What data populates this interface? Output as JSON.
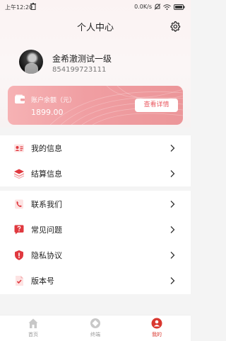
{
  "status": {
    "time": "上午12:20",
    "network": "0.0K/s",
    "battery": "100"
  },
  "header": {
    "title": "个人中心"
  },
  "profile": {
    "name": "金希澈测试一级",
    "phone": "854199723111"
  },
  "account": {
    "label": "账户余额（元）",
    "amount": "1899.00",
    "detail_button": "查看详情"
  },
  "menu_group1": [
    {
      "label": "我的信息",
      "icon": "id-card-icon"
    },
    {
      "label": "结算信息",
      "icon": "stack-icon"
    }
  ],
  "menu_group2": [
    {
      "label": "联系我们",
      "icon": "phone-icon"
    },
    {
      "label": "常见问题",
      "icon": "question-icon"
    },
    {
      "label": "隐私协议",
      "icon": "shield-icon"
    },
    {
      "label": "版本号",
      "icon": "document-icon"
    }
  ],
  "tabs": [
    {
      "label": "首页",
      "active": false
    },
    {
      "label": "终端",
      "active": false
    },
    {
      "label": "我的",
      "active": true
    }
  ],
  "colors": {
    "accent": "#e5484d",
    "card": "#f09ea2",
    "icon_red": "#e0393f"
  }
}
